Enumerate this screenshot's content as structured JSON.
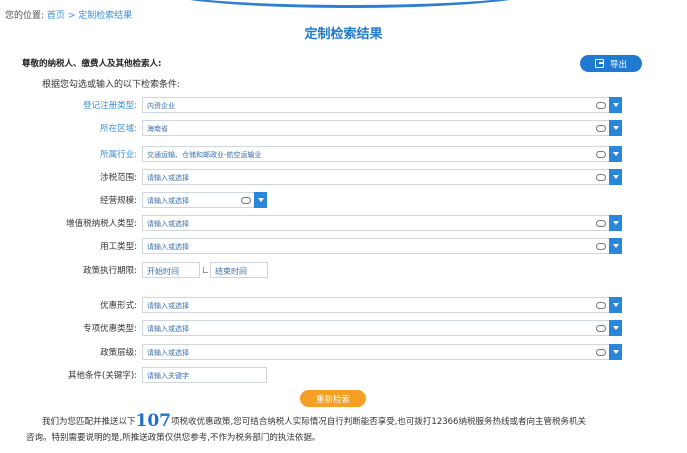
{
  "breadcrumb": {
    "prefix": "您的位置:",
    "home": "首页",
    "separator": ">",
    "current": "定制检索结果"
  },
  "page_title": "定制检索结果",
  "greeting": "尊敬的纳税人、缴费人及其他检索人:",
  "export_label": "导出",
  "conditions_intro": "根据您勾选或输入的以下检索条件:",
  "fields": {
    "registration_type": {
      "label": "登记注册类型:",
      "value": "内资企业"
    },
    "region": {
      "label": "所在区域:",
      "value": "海南省"
    },
    "industry": {
      "label": "所属行业:",
      "value": "交通运输、仓储和邮政业-航空运输业"
    },
    "tax_scope": {
      "label": "涉税范围:",
      "value": "请输入或选择"
    },
    "business_scale": {
      "label": "经营规模:",
      "value": "请输入或选择"
    },
    "vat_taxpayer_type": {
      "label": "增值税纳税人类型:",
      "value": "请输入或选择"
    },
    "employment_type": {
      "label": "用工类型:",
      "value": "请输入或选择"
    },
    "policy_period": {
      "label": "政策执行期限:",
      "start": "开始时间",
      "end": "结束时间"
    },
    "preference_form": {
      "label": "优惠形式:",
      "value": "请输入或选择"
    },
    "special_preference_type": {
      "label": "专项优惠类型:",
      "value": "请输入或选择"
    },
    "policy_level": {
      "label": "政策层级:",
      "value": "请输入或选择"
    },
    "other_conditions": {
      "label": "其他条件(关键字):",
      "placeholder": "请输入关键字"
    }
  },
  "search_again_label": "重新检索",
  "notice": {
    "part1": "我们为您匹配并推送以下",
    "count": "107",
    "part2": "项税收优惠政策,您可结合纳税人实际情况自行判断能否享受,也可拨打12366纳税服务热线或者向主管税务机关",
    "part3": "咨询。特别需要说明的是,所推送政策仅供您参考,不作为税务部门的执法依据。"
  },
  "colors": {
    "primary": "#1f7ad1",
    "accent": "#f5a024",
    "link": "#3a8fd9"
  }
}
